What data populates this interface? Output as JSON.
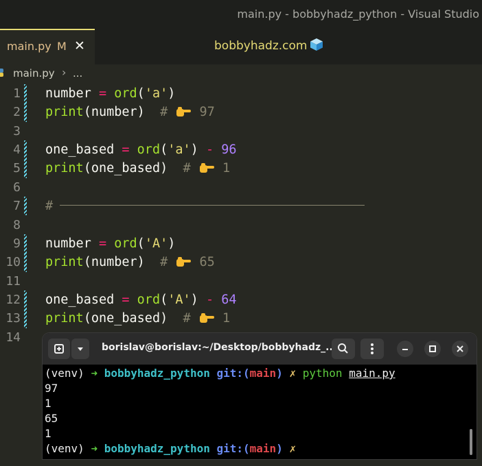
{
  "window": {
    "title": "main.py - bobbyhadz_python - Visual Studio"
  },
  "tab": {
    "name": "main.py",
    "modified": "M",
    "close": "✕"
  },
  "banner": {
    "text": "bobbyhadz.com"
  },
  "breadcrumb": {
    "file": "main.py",
    "separator": "›",
    "more": "..."
  },
  "code": {
    "line_numbers": [
      "1",
      "2",
      "3",
      "4",
      "5",
      "6",
      "7",
      "8",
      "9",
      "10",
      "11",
      "12",
      "13",
      "14"
    ],
    "l1": {
      "var": "number",
      "eq": "=",
      "fn": "ord",
      "p1": "(",
      "arg": "'a'",
      "p2": ")"
    },
    "l2": {
      "fn": "print",
      "p1": "(",
      "arg": "number",
      "p2": ")",
      "hash": "#",
      "value": "97"
    },
    "l4": {
      "var": "one_based",
      "eq": "=",
      "fn": "ord",
      "p1": "(",
      "arg": "'a'",
      "p2": ")",
      "minus": "-",
      "num": "96"
    },
    "l5": {
      "fn": "print",
      "p1": "(",
      "arg": "one_based",
      "p2": ")",
      "hash": "#",
      "value": "1"
    },
    "l7": {
      "hash": "#"
    },
    "l9": {
      "var": "number",
      "eq": "=",
      "fn": "ord",
      "p1": "(",
      "arg": "'A'",
      "p2": ")"
    },
    "l10": {
      "fn": "print",
      "p1": "(",
      "arg": "number",
      "p2": ")",
      "hash": "#",
      "value": "65"
    },
    "l12": {
      "var": "one_based",
      "eq": "=",
      "fn": "ord",
      "p1": "(",
      "arg": "'A'",
      "p2": ")",
      "minus": "-",
      "num": "64"
    },
    "l13": {
      "fn": "print",
      "p1": "(",
      "arg": "one_based",
      "p2": ")",
      "hash": "#",
      "value": "1"
    }
  },
  "terminal": {
    "title": "borislav@borislav:~/Desktop/bobbyhadz_...",
    "prompt": {
      "venv": "(venv)",
      "arrow": "➜",
      "dir": "bobbyhadz_python",
      "git": "git:(",
      "branch": "main",
      "close": ")",
      "dirty": "✗"
    },
    "command": {
      "cmd": "python",
      "arg": "main.py"
    },
    "output": [
      "97",
      "1",
      "65",
      "1"
    ]
  },
  "colors": {
    "editor_bg": "#272822",
    "accent": "#e6db74",
    "terminal_bg": "#000000"
  }
}
